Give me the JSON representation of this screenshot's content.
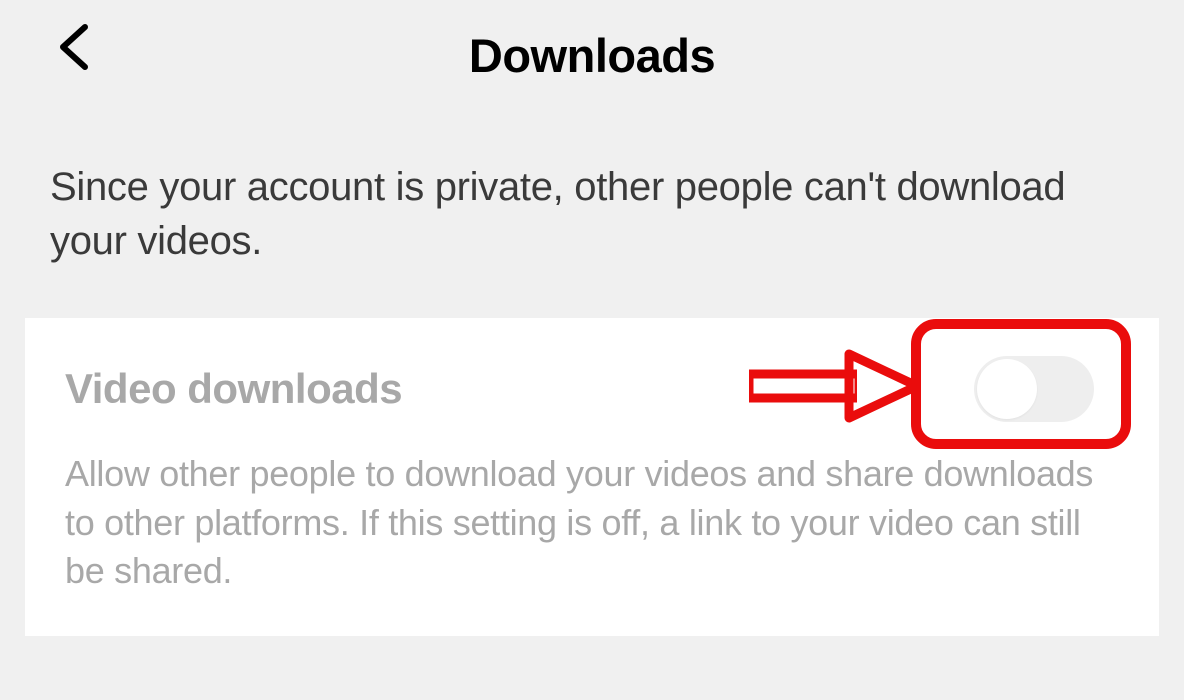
{
  "header": {
    "title": "Downloads"
  },
  "info_text": "Since your account is private, other people can't download your videos.",
  "setting": {
    "label": "Video downloads",
    "description": "Allow other people to download your videos and share downloads to other platforms. If this setting is off, a link to your video can still be shared.",
    "toggle_state": "off"
  },
  "annotation": {
    "color": "#ea0c0c"
  }
}
